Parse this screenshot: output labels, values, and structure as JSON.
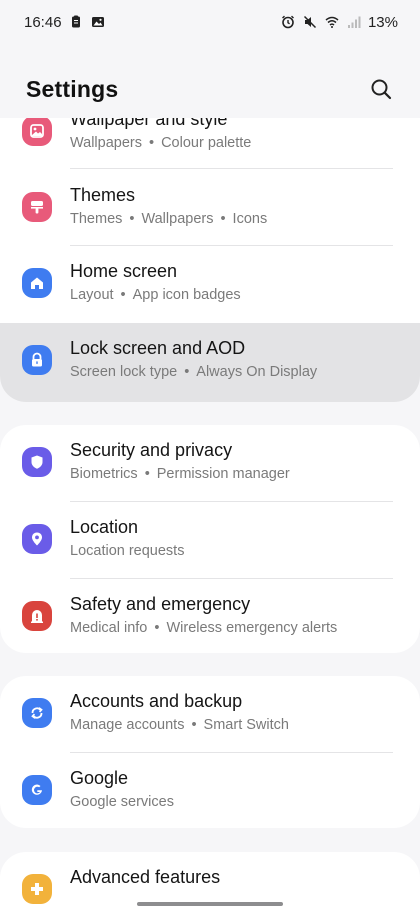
{
  "status_bar": {
    "time": "16:46",
    "battery": "13%",
    "icons_left": [
      "clipboard-icon",
      "gallery-icon"
    ],
    "icons_right": [
      "alarm-icon",
      "mute-icon",
      "wifi-icon",
      "signal-icon"
    ]
  },
  "header": {
    "title": "Settings",
    "search_icon": "search-icon"
  },
  "groups": [
    {
      "items": [
        {
          "title": "Wallpaper and style",
          "subtitle": [
            "Wallpapers",
            "Colour palette"
          ],
          "icon": "wallpaper-icon",
          "color": "#e85a7a"
        },
        {
          "title": "Themes",
          "subtitle": [
            "Themes",
            "Wallpapers",
            "Icons"
          ],
          "icon": "brush-icon",
          "color": "#e85a7a"
        },
        {
          "title": "Home screen",
          "subtitle": [
            "Layout",
            "App icon badges"
          ],
          "icon": "home-icon",
          "color": "#3f7cf0"
        },
        {
          "title": "Lock screen and AOD",
          "subtitle": [
            "Screen lock type",
            "Always On Display"
          ],
          "icon": "lock-icon",
          "color": "#3f7cf0",
          "selected": true
        }
      ]
    },
    {
      "items": [
        {
          "title": "Security and privacy",
          "subtitle": [
            "Biometrics",
            "Permission manager"
          ],
          "icon": "shield-icon",
          "color": "#6a5ce8"
        },
        {
          "title": "Location",
          "subtitle": [
            "Location requests"
          ],
          "icon": "location-pin-icon",
          "color": "#6a5ce8"
        },
        {
          "title": "Safety and emergency",
          "subtitle": [
            "Medical info",
            "Wireless emergency alerts"
          ],
          "icon": "emergency-icon",
          "color": "#d9443d"
        }
      ]
    },
    {
      "items": [
        {
          "title": "Accounts and backup",
          "subtitle": [
            "Manage accounts",
            "Smart Switch"
          ],
          "icon": "sync-icon",
          "color": "#3f7cf0"
        },
        {
          "title": "Google",
          "subtitle": [
            "Google services"
          ],
          "icon": "google-icon",
          "color": "#3f7cf0"
        }
      ]
    },
    {
      "items": [
        {
          "title": "Advanced features",
          "subtitle": [],
          "icon": "advanced-features-icon",
          "color": "#f2b23b"
        }
      ]
    }
  ],
  "separator": "•"
}
